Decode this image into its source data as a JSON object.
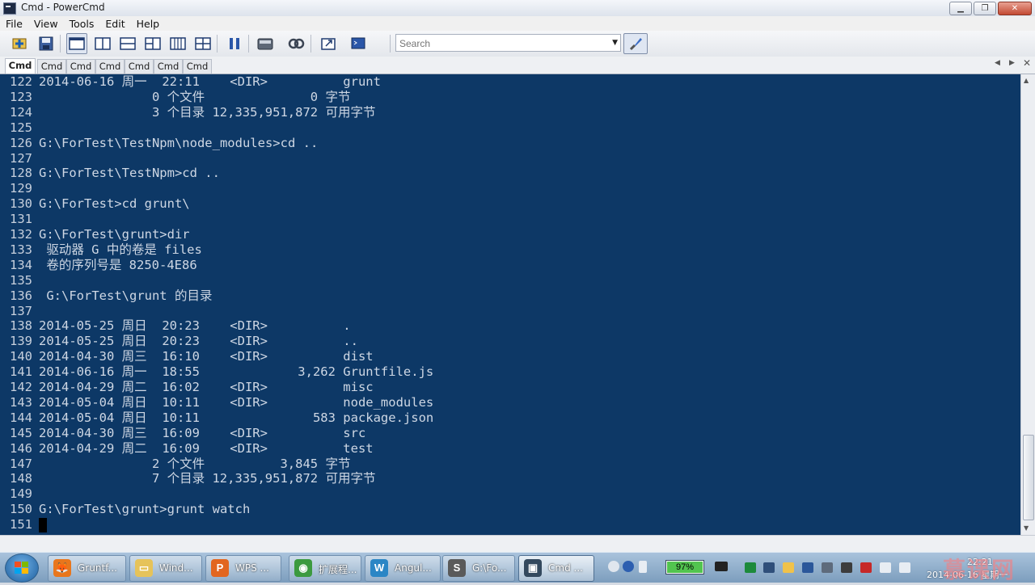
{
  "window": {
    "title": "Cmd - PowerCmd"
  },
  "menu": [
    "File",
    "View",
    "Tools",
    "Edit",
    "Help"
  ],
  "toolbar": {
    "search_placeholder": "Search",
    "icons": [
      "new-session-icon",
      "save-icon",
      "layout-single-icon",
      "layout-split-vertical-icon",
      "layout-split-horizontal-icon",
      "layout-three-icon",
      "layout-four-columns-icon",
      "layout-grid-icon",
      "pause-icon",
      "calculator-icon",
      "link-icon",
      "external-window-icon",
      "cmd-prompt-icon",
      "brush-icon"
    ]
  },
  "tabs": [
    "Cmd",
    "Cmd",
    "Cmd",
    "Cmd",
    "Cmd",
    "Cmd",
    "Cmd"
  ],
  "active_tab": 0,
  "console": {
    "lines": [
      {
        "n": "122",
        "t": "2014-06-16 周一  22:11    <DIR>          grunt"
      },
      {
        "n": "123",
        "t": "               0 个文件              0 字节"
      },
      {
        "n": "124",
        "t": "               3 个目录 12,335,951,872 可用字节"
      },
      {
        "n": "125",
        "t": ""
      },
      {
        "n": "126",
        "t": "G:\\ForTest\\TestNpm\\node_modules>cd .."
      },
      {
        "n": "127",
        "t": ""
      },
      {
        "n": "128",
        "t": "G:\\ForTest\\TestNpm>cd .."
      },
      {
        "n": "129",
        "t": ""
      },
      {
        "n": "130",
        "t": "G:\\ForTest>cd grunt\\"
      },
      {
        "n": "131",
        "t": ""
      },
      {
        "n": "132",
        "t": "G:\\ForTest\\grunt>dir"
      },
      {
        "n": "133",
        "t": " 驱动器 G 中的卷是 files"
      },
      {
        "n": "134",
        "t": " 卷的序列号是 8250-4E86"
      },
      {
        "n": "135",
        "t": ""
      },
      {
        "n": "136",
        "t": " G:\\ForTest\\grunt 的目录"
      },
      {
        "n": "137",
        "t": ""
      },
      {
        "n": "138",
        "t": "2014-05-25 周日  20:23    <DIR>          ."
      },
      {
        "n": "139",
        "t": "2014-05-25 周日  20:23    <DIR>          .."
      },
      {
        "n": "140",
        "t": "2014-04-30 周三  16:10    <DIR>          dist"
      },
      {
        "n": "141",
        "t": "2014-06-16 周一  18:55             3,262 Gruntfile.js"
      },
      {
        "n": "142",
        "t": "2014-04-29 周二  16:02    <DIR>          misc"
      },
      {
        "n": "143",
        "t": "2014-05-04 周日  10:11    <DIR>          node_modules"
      },
      {
        "n": "144",
        "t": "2014-05-04 周日  10:11               583 package.json"
      },
      {
        "n": "145",
        "t": "2014-04-30 周三  16:09    <DIR>          src"
      },
      {
        "n": "146",
        "t": "2014-04-29 周二  16:09    <DIR>          test"
      },
      {
        "n": "147",
        "t": "               2 个文件          3,845 字节"
      },
      {
        "n": "148",
        "t": "               7 个目录 12,335,951,872 可用字节"
      },
      {
        "n": "149",
        "t": ""
      },
      {
        "n": "150",
        "t": "G:\\ForTest\\grunt>grunt watch"
      },
      {
        "n": "151",
        "t": ""
      }
    ]
  },
  "taskbar": {
    "items": [
      {
        "label": "Gruntf...",
        "icon": "firefox-icon",
        "color": "#e8761c",
        "glyph": "🦊"
      },
      {
        "label": "Wind...",
        "icon": "folder-icon",
        "color": "#e6c35a",
        "glyph": "▭"
      },
      {
        "label": "WPS ...",
        "icon": "wps-presentation-icon",
        "color": "#e2661f",
        "glyph": "P"
      },
      {
        "label": "扩展程...",
        "icon": "chrome-icon",
        "color": "#3c9a3f",
        "glyph": "◉"
      },
      {
        "label": "Angul...",
        "icon": "webstorm-icon",
        "color": "#2b86c5",
        "glyph": "W"
      },
      {
        "label": "G:\\Fo...",
        "icon": "sublime-text-icon",
        "color": "#5a5a5a",
        "glyph": "S"
      },
      {
        "label": "Cmd ...",
        "icon": "powercmd-icon",
        "color": "#34495e",
        "glyph": "▣"
      }
    ],
    "battery_percent": "97%",
    "clock_time": "22:21",
    "clock_date": "2014-06-16 星期一"
  },
  "watermark": "慕课网"
}
